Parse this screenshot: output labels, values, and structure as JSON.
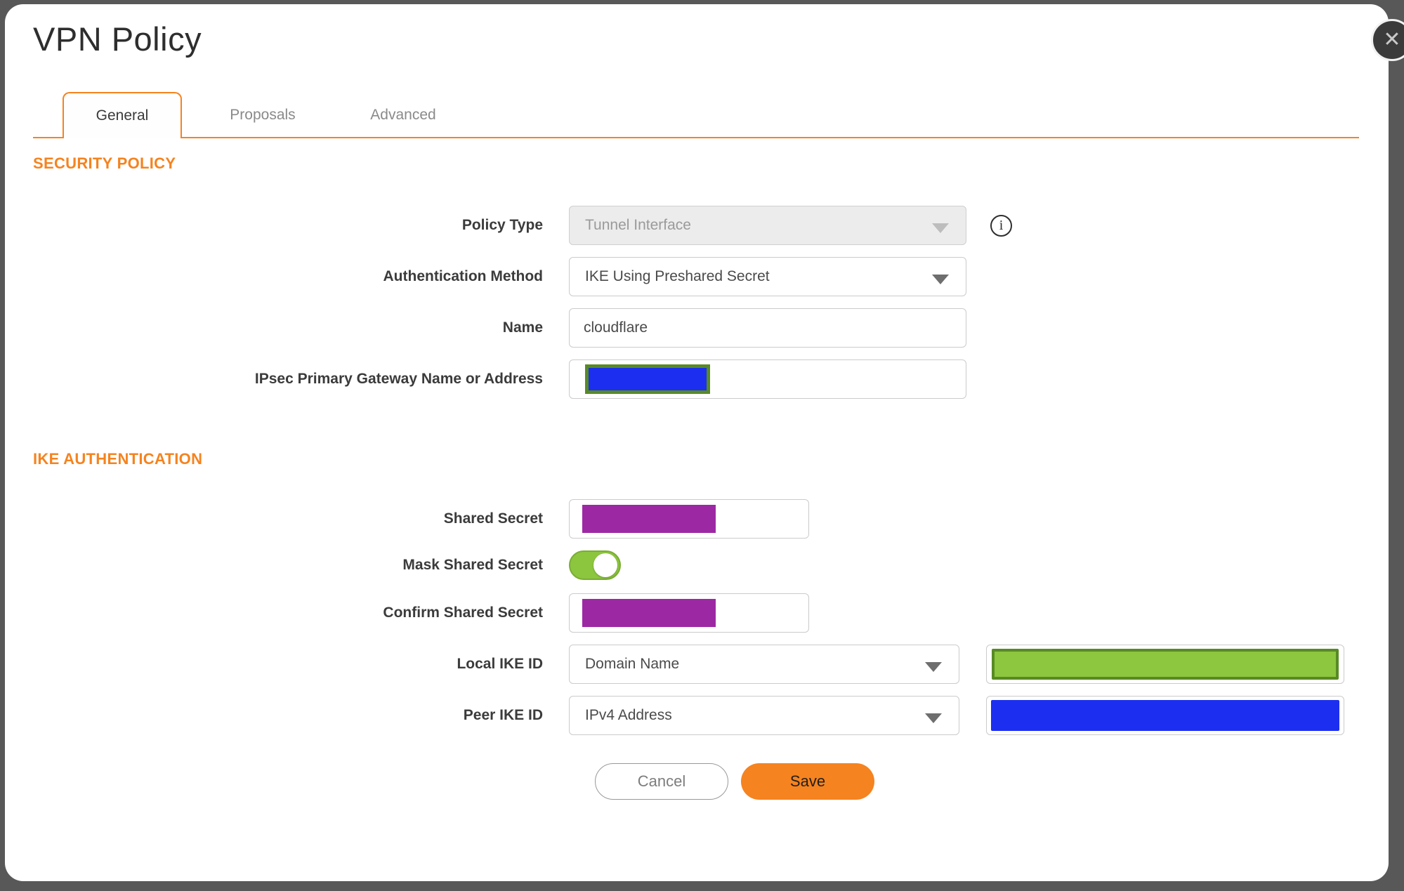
{
  "colors": {
    "accent": "#f5831f",
    "title_text": "#2e2e2e",
    "label_text": "#3b3b3b",
    "backdrop": "#585858",
    "redaction_blue": "#1c2ff0",
    "redaction_purple": "#9d28a4",
    "redaction_green_fill": "#8dc63f",
    "redaction_green_border": "#588a24",
    "toggle_on": "#8cc63e"
  },
  "window": {
    "title": "VPN Policy",
    "close_icon": "✕"
  },
  "tabs": {
    "items": [
      {
        "label": "General",
        "active": true
      },
      {
        "label": "Proposals",
        "active": false
      },
      {
        "label": "Advanced",
        "active": false
      }
    ]
  },
  "security_policy": {
    "heading": "SECURITY POLICY",
    "policy_type": {
      "label": "Policy Type",
      "value": "Tunnel Interface",
      "disabled": true,
      "info_icon": "i"
    },
    "authentication_method": {
      "label": "Authentication Method",
      "value": "IKE Using Preshared Secret"
    },
    "name": {
      "label": "Name",
      "value": "cloudflare"
    },
    "gateway": {
      "label": "IPsec Primary Gateway Name or Address",
      "value_masked": true
    }
  },
  "ike_authentication": {
    "heading": "IKE AUTHENTICATION",
    "shared_secret": {
      "label": "Shared Secret",
      "value_masked": true
    },
    "mask_shared_secret": {
      "label": "Mask Shared Secret",
      "state": "on"
    },
    "confirm_shared_secret": {
      "label": "Confirm Shared Secret",
      "value_masked": true
    },
    "local_ike_id": {
      "label": "Local IKE ID",
      "selected": "Domain Name",
      "value_masked": true
    },
    "peer_ike_id": {
      "label": "Peer IKE ID",
      "selected": "IPv4 Address",
      "value_masked": true
    }
  },
  "footer": {
    "cancel_label": "Cancel",
    "save_label": "Save"
  }
}
